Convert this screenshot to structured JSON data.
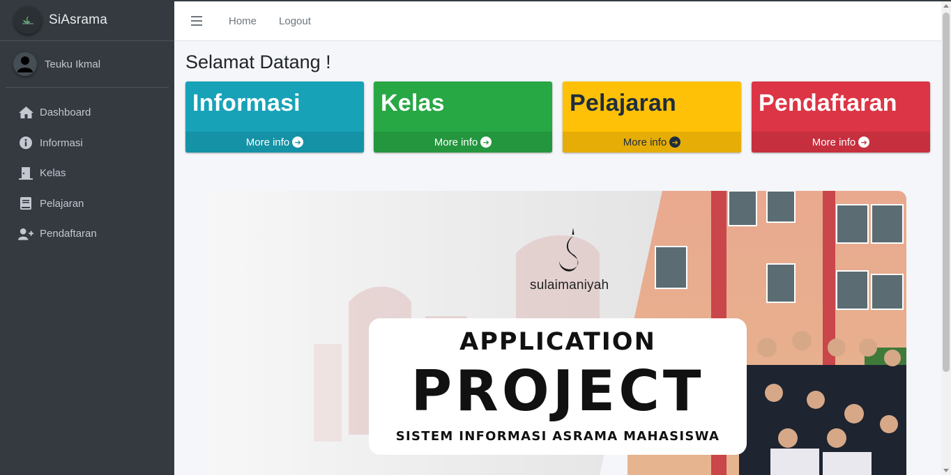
{
  "brand": {
    "name": "SiAsrama"
  },
  "user": {
    "name": "Teuku Ikmal"
  },
  "sidebar": {
    "items": [
      {
        "label": "Dashboard",
        "icon": "home-icon"
      },
      {
        "label": "Informasi",
        "icon": "info-circle-icon"
      },
      {
        "label": "Kelas",
        "icon": "door-icon"
      },
      {
        "label": "Pelajaran",
        "icon": "book-icon"
      },
      {
        "label": "Pendaftaran",
        "icon": "user-plus-icon"
      }
    ]
  },
  "navbar": {
    "home": "Home",
    "logout": "Logout"
  },
  "page": {
    "title": "Selamat Datang !"
  },
  "boxes": [
    {
      "title": "Informasi",
      "footer": "More info",
      "color": "#17a2b8"
    },
    {
      "title": "Kelas",
      "footer": "More info",
      "color": "#28a745"
    },
    {
      "title": "Pelajaran",
      "footer": "More info",
      "color": "#ffc107"
    },
    {
      "title": "Pendaftaran",
      "footer": "More info",
      "color": "#dc3545"
    }
  ],
  "banner": {
    "logo_text": "sulaimaniyah",
    "line1": "APPLICATION",
    "line2": "PROJECT",
    "line3": "SISTEM INFORMASI ASRAMA MAHASISWA"
  }
}
